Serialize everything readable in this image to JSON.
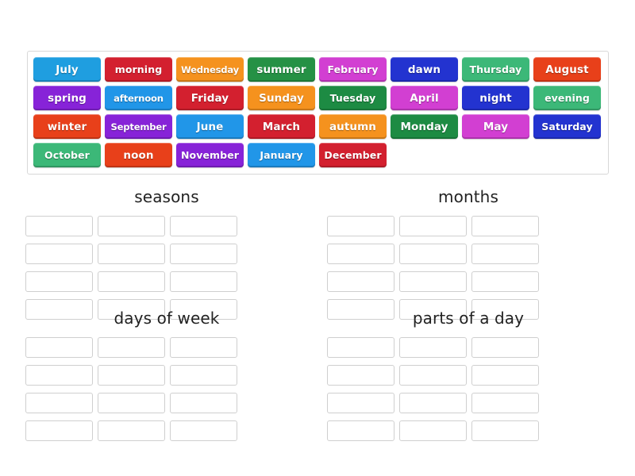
{
  "word_bank": {
    "name": "word-bank",
    "tiles": [
      {
        "label": "July",
        "color": "#1f9ee0"
      },
      {
        "label": "morning",
        "color": "#d3202f"
      },
      {
        "label": "Wednesday",
        "color": "#f5921e"
      },
      {
        "label": "summer",
        "color": "#259145"
      },
      {
        "label": "February",
        "color": "#d23fd2"
      },
      {
        "label": "dawn",
        "color": "#2333d0"
      },
      {
        "label": "Thursday",
        "color": "#3cb878"
      },
      {
        "label": "August",
        "color": "#e8401a"
      },
      {
        "label": "spring",
        "color": "#8723d8"
      },
      {
        "label": "afternoon",
        "color": "#2196e8"
      },
      {
        "label": "Friday",
        "color": "#d3202f"
      },
      {
        "label": "Sunday",
        "color": "#f5921e"
      },
      {
        "label": "Tuesday",
        "color": "#1d8b43"
      },
      {
        "label": "April",
        "color": "#d23fd2"
      },
      {
        "label": "night",
        "color": "#2333d0"
      },
      {
        "label": "evening",
        "color": "#3cb878"
      },
      {
        "label": "winter",
        "color": "#e8401a"
      },
      {
        "label": "September",
        "color": "#8723d8"
      },
      {
        "label": "June",
        "color": "#2196e8"
      },
      {
        "label": "March",
        "color": "#d3202f"
      },
      {
        "label": "autumn",
        "color": "#f5921e"
      },
      {
        "label": "Monday",
        "color": "#1d8b43"
      },
      {
        "label": "May",
        "color": "#d23fd2"
      },
      {
        "label": "Saturday",
        "color": "#2333d0"
      },
      {
        "label": "October",
        "color": "#3cb878"
      },
      {
        "label": "noon",
        "color": "#e8401a"
      },
      {
        "label": "November",
        "color": "#8723d8"
      },
      {
        "label": "January",
        "color": "#2196e8"
      },
      {
        "label": "December",
        "color": "#d3202f"
      }
    ]
  },
  "groups": [
    {
      "id": "seasons",
      "title": "seasons",
      "slot_count": 12,
      "slots": [
        "",
        "",
        "",
        "",
        "",
        "",
        "",
        "",
        "",
        "",
        "",
        ""
      ]
    },
    {
      "id": "months",
      "title": "months",
      "slot_count": 12,
      "slots": [
        "",
        "",
        "",
        "",
        "",
        "",
        "",
        "",
        "",
        "",
        "",
        ""
      ]
    },
    {
      "id": "days-of-week",
      "title": "days of week",
      "slot_count": 12,
      "slots": [
        "",
        "",
        "",
        "",
        "",
        "",
        "",
        "",
        "",
        "",
        "",
        ""
      ]
    },
    {
      "id": "parts-of-day",
      "title": "parts of a day",
      "slot_count": 12,
      "slots": [
        "",
        "",
        "",
        "",
        "",
        "",
        "",
        "",
        "",
        "",
        "",
        ""
      ]
    }
  ]
}
